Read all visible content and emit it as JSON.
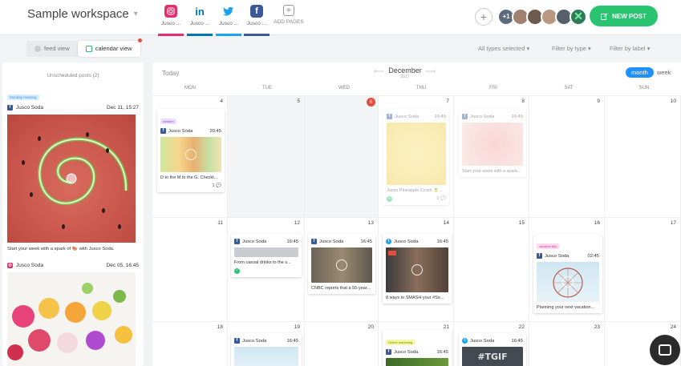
{
  "workspace": {
    "name": "Sample workspace"
  },
  "accounts": [
    {
      "name": "instagram-icon",
      "label": "Jusco ...",
      "glyph": "◎",
      "color": "#e1306c",
      "bar": "#e1306c"
    },
    {
      "name": "linkedin-icon",
      "label": "Jusco ...",
      "glyph": "in",
      "color": "#0077b5",
      "bar": "#0077b5"
    },
    {
      "name": "twitter-icon",
      "label": "Jusco ...",
      "glyph": "🐦",
      "color": "#1da1f2",
      "bar": "#1da1f2"
    },
    {
      "name": "facebook-icon",
      "label": "Jusco ...",
      "glyph": "f",
      "color": "#3b5998",
      "bar": "#3b5998"
    }
  ],
  "add_pages": {
    "label": "ADD PAGES",
    "glyph": "+"
  },
  "team": {
    "add_glyph": "+",
    "count": "+1"
  },
  "new_post": {
    "label": "NEW POST"
  },
  "views": {
    "feed": "feed view",
    "calendar": "calendar view"
  },
  "filters": {
    "types": "All types selected",
    "by_type": "Filter by type",
    "by_label": "Filter by label"
  },
  "unscheduled": {
    "title": "Unscheduled posts (2)",
    "posts": [
      {
        "tag": "Monday morning",
        "account": "Jusco Soda",
        "date": "Dec 11, 15:27",
        "caption": "Start your week with a spark of 🍉 with Jusco Soda."
      },
      {
        "account": "Jusco Soda",
        "date": "Dec 05, 16:45"
      }
    ]
  },
  "calendar": {
    "today_label": "Today",
    "month": "December",
    "year": "2017",
    "month_btn": "month",
    "week_btn": "week",
    "days": [
      "MON",
      "TUE",
      "WED",
      "THU",
      "FRI",
      "SAT",
      "SUN"
    ],
    "weeks": [
      [
        "4",
        "5",
        "6",
        "7",
        "8",
        "9",
        "10"
      ],
      [
        "11",
        "12",
        "13",
        "14",
        "15",
        "16",
        "17"
      ],
      [
        "18",
        "19",
        "20",
        "21",
        "22",
        "23",
        "24"
      ]
    ],
    "posts": {
      "mon4": {
        "tag": "random",
        "account": "Jusco Soda",
        "time": "20:45",
        "text": "D to the M to the G. Checkt...",
        "comments": "1"
      },
      "thu7": {
        "account": "Jusco Soda",
        "time": "16:45",
        "text": "Jusco Pineapple Crush 🍍...",
        "comments": "0"
      },
      "fri8": {
        "account": "Jusco Soda",
        "time": "16:45",
        "text": "Start your week with a spark..."
      },
      "tue12": {
        "account": "Jusco Soda",
        "time": "16:45",
        "text": "From casual drinks to the s..."
      },
      "wed13": {
        "account": "Jusco Soda",
        "time": "16:45",
        "text": "CNBC reports that a 55-year..."
      },
      "thu14": {
        "account": "Jusco Soda",
        "time": "16:45",
        "text": "8 ways to SMASH your #So..."
      },
      "sat16": {
        "tag": "vacation tips",
        "account": "Jusco Soda",
        "time": "02:45",
        "text": "Planning your next vacation..."
      },
      "tue19": {
        "account": "Jusco Soda",
        "time": "16:45"
      },
      "thu21": {
        "tag": "Online marketing",
        "account": "Jusco Soda",
        "time": "16:45"
      },
      "fri22": {
        "account": "Jusco Soda",
        "time": "16:45",
        "img_text": "#TGIF"
      }
    }
  }
}
